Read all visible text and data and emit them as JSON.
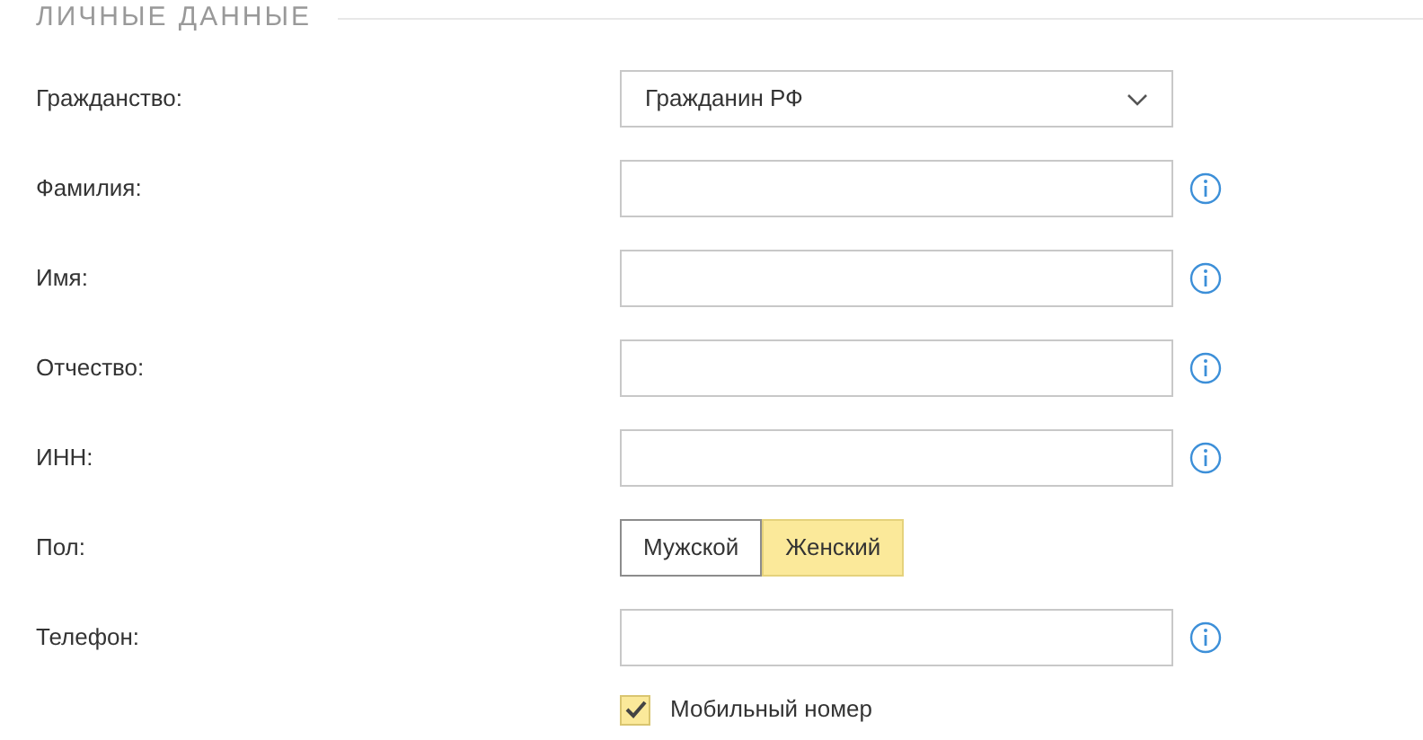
{
  "section": {
    "title": "ЛИЧНЫЕ ДАННЫЕ"
  },
  "rows": [
    {
      "kind": "select",
      "label": "Гражданство:",
      "value": "Гражданин РФ"
    },
    {
      "kind": "text",
      "label": "Фамилия:",
      "info": true
    },
    {
      "kind": "text",
      "label": "Имя:",
      "info": true
    },
    {
      "kind": "text",
      "label": "Отчество:",
      "info": true
    },
    {
      "kind": "text",
      "label": "ИНН:",
      "info": true
    },
    {
      "kind": "segmented",
      "label": "Пол:",
      "options": [
        {
          "label": "Мужской",
          "selected": false
        },
        {
          "label": "Женский",
          "selected": true
        }
      ]
    },
    {
      "kind": "text",
      "label": "Телефон:",
      "info": true
    }
  ],
  "mobile": {
    "label": "Мобильный номер",
    "checked": true
  }
}
